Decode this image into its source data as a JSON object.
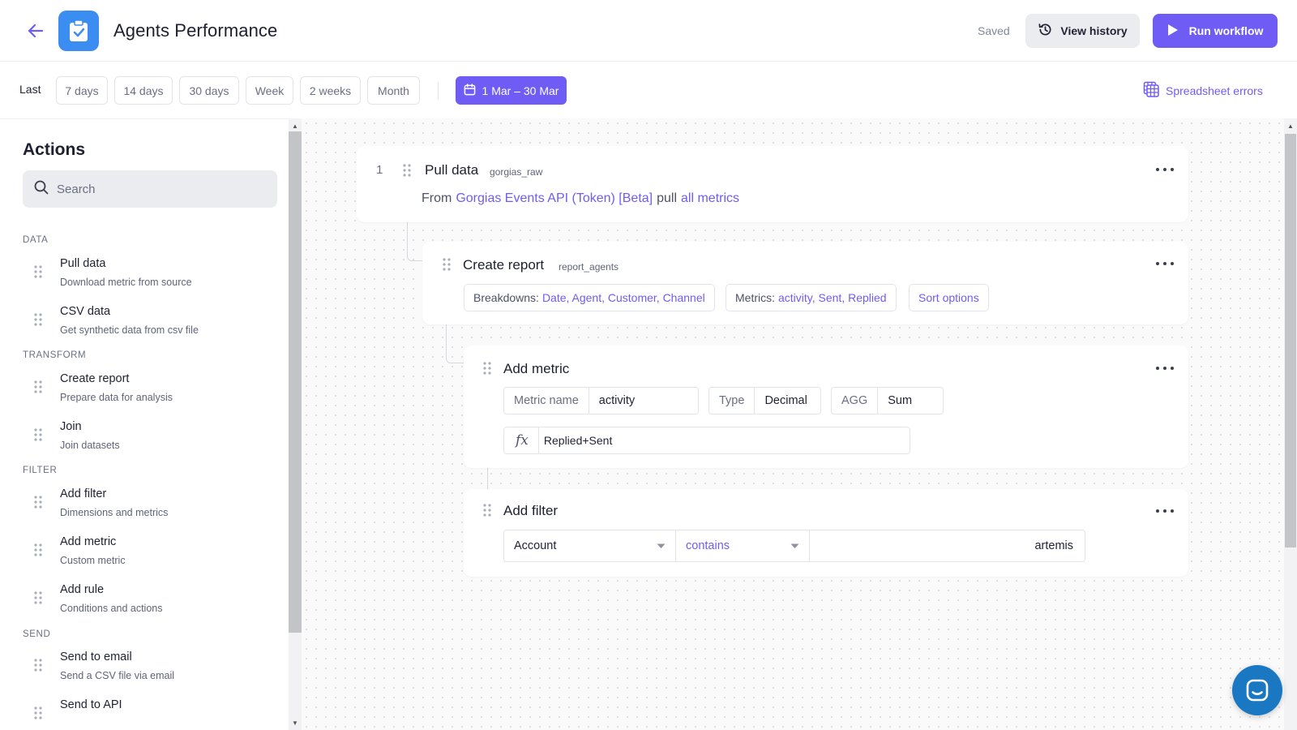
{
  "header": {
    "title": "Agents Performance",
    "status": "Saved",
    "view_history_label": "View history",
    "run_workflow_label": "Run workflow"
  },
  "filterbar": {
    "last_label": "Last",
    "ranges": [
      "7 days",
      "14 days",
      "30 days",
      "Week",
      "2 weeks",
      "Month"
    ],
    "date_range": "1 Mar – 30 Mar",
    "spreadsheet_errors_label": "Spreadsheet errors"
  },
  "sidebar": {
    "title": "Actions",
    "search_placeholder": "Search",
    "sections": [
      {
        "label": "DATA",
        "items": [
          {
            "title": "Pull data",
            "subtitle": "Download metric from source"
          },
          {
            "title": "CSV data",
            "subtitle": "Get synthetic data from csv file"
          }
        ]
      },
      {
        "label": "TRANSFORM",
        "items": [
          {
            "title": "Create report",
            "subtitle": "Prepare data for analysis"
          },
          {
            "title": "Join",
            "subtitle": "Join datasets"
          }
        ]
      },
      {
        "label": "FILTER",
        "items": [
          {
            "title": "Add filter",
            "subtitle": "Dimensions and metrics"
          },
          {
            "title": "Add metric",
            "subtitle": "Custom metric"
          },
          {
            "title": "Add rule",
            "subtitle": "Conditions and actions"
          }
        ]
      },
      {
        "label": "SEND",
        "items": [
          {
            "title": "Send to email",
            "subtitle": "Send a CSV file via email"
          },
          {
            "title": "Send to API",
            "subtitle": ""
          }
        ]
      }
    ]
  },
  "workflow": {
    "pull": {
      "number": "1",
      "title": "Pull data",
      "id": "gorgias_raw",
      "from_word": "From",
      "source": "Gorgias Events API (Token) [Beta]",
      "pull_word": "pull",
      "metrics": "all metrics"
    },
    "report": {
      "title": "Create report",
      "id": "report_agents",
      "breakdowns_label": "Breakdowns:",
      "breakdowns": "Date, Agent, Customer, Channel",
      "metrics_label": "Metrics:",
      "metrics": "activity, Sent, Replied",
      "sort_label": "Sort options"
    },
    "metric": {
      "title": "Add metric",
      "name_label": "Metric name",
      "name_value": "activity",
      "type_label": "Type",
      "type_value": "Decimal",
      "agg_label": "AGG",
      "agg_value": "Sum",
      "fx_symbol": "fx",
      "formula": "Replied+Sent"
    },
    "filter": {
      "title": "Add filter",
      "field": "Account",
      "operator": "contains",
      "value": "artemis"
    }
  },
  "colors": {
    "accent": "#6f5cf5",
    "logo": "#3b8df1",
    "chat": "#1a78c2"
  }
}
